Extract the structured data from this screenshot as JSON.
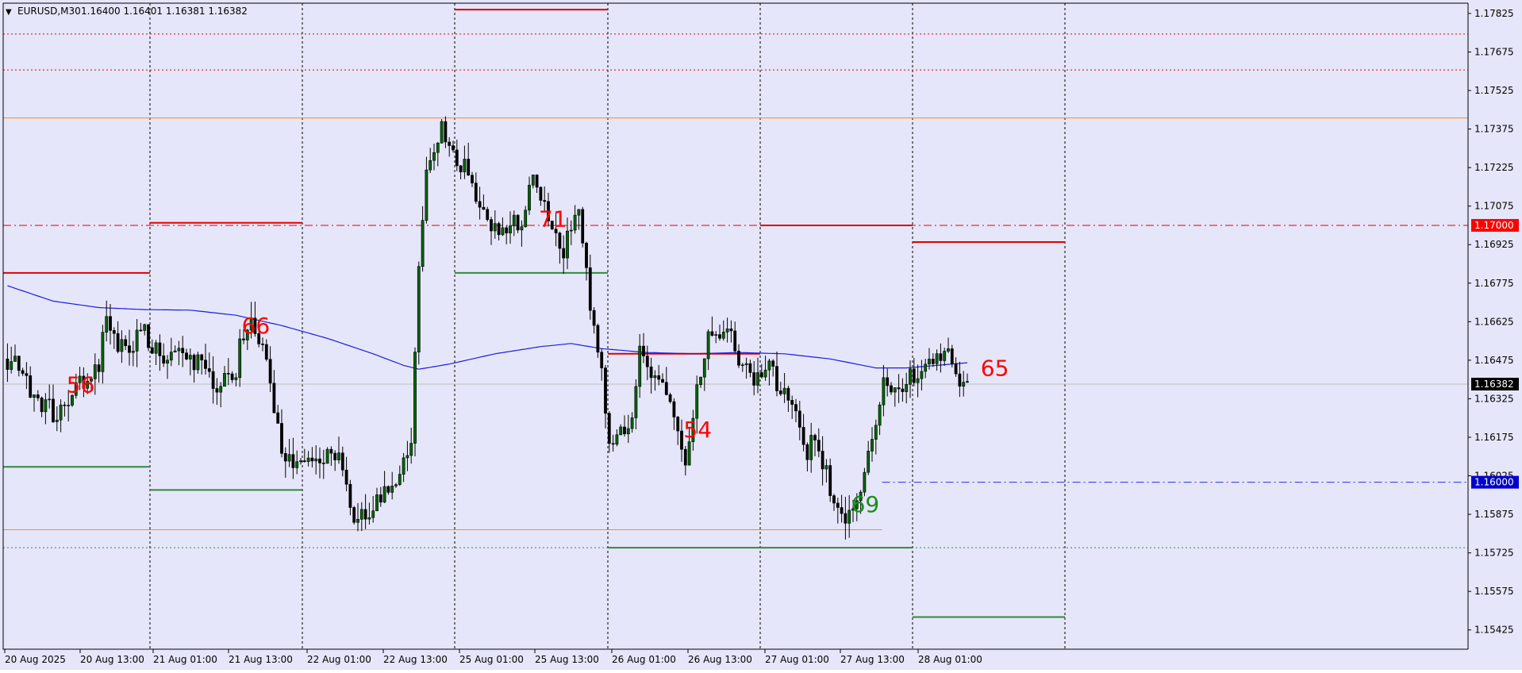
{
  "header": {
    "title": "EURUSD,M30",
    "quote": "1.16400 1.16401 1.16381 1.16382",
    "menu_icon": "triangle-down-icon"
  },
  "colors": {
    "background": "#E6E6FA",
    "grid": "#000000",
    "bull_body": "#006400",
    "bear_body": "#000000",
    "wick": "#000000",
    "ma": "#1c1ce0",
    "red": "#e00000",
    "green": "#2e8b3a",
    "orange": "#ff8c1a",
    "blue_dash": "#2a2aff",
    "gray": "#bfbfbf",
    "label_red": "#ff0000",
    "label_green": "#1a8c1a",
    "current_tag": "#000000",
    "red_tag": "#ff0000",
    "blue_tag": "#0000cc"
  },
  "chart_data": {
    "type": "candlestick",
    "symbol": "EURUSD",
    "timeframe": "M30",
    "ylim": [
      1.1535,
      1.17865
    ],
    "y_ticks": [
      "1.17825",
      "1.17675",
      "1.17525",
      "1.17375",
      "1.17225",
      "1.17075",
      "1.16925",
      "1.16775",
      "1.16625",
      "1.16475",
      "1.16325",
      "1.16175",
      "1.16025",
      "1.15875",
      "1.15725",
      "1.15575",
      "1.15425"
    ],
    "x_ticks": [
      "20 Aug 2025",
      "20 Aug 13:00",
      "21 Aug 01:00",
      "21 Aug 13:00",
      "22 Aug 01:00",
      "22 Aug 13:00",
      "25 Aug 01:00",
      "25 Aug 13:00",
      "26 Aug 01:00",
      "26 Aug 13:00",
      "27 Aug 01:00",
      "27 Aug 13:00",
      "28 Aug 01:00"
    ],
    "current_price": "1.16382",
    "tagged_levels": [
      {
        "value": 1.17,
        "label": "1.17000",
        "color": "red"
      },
      {
        "value": 1.16,
        "label": "1.16000",
        "color": "blue"
      }
    ],
    "series_points": [
      [
        0,
        1.1648
      ],
      [
        2,
        1.1642
      ],
      [
        4,
        1.1632
      ],
      [
        6,
        1.1627
      ],
      [
        8,
        1.1632
      ],
      [
        10,
        1.1641
      ],
      [
        12,
        1.1647
      ],
      [
        13,
        1.1664
      ],
      [
        14,
        1.1656
      ],
      [
        16,
        1.1652
      ],
      [
        18,
        1.1658
      ],
      [
        20,
        1.165
      ],
      [
        22,
        1.1648
      ],
      [
        24,
        1.1647
      ],
      [
        26,
        1.1645
      ],
      [
        27,
        1.1638
      ],
      [
        28,
        1.164
      ],
      [
        30,
        1.1645
      ],
      [
        31,
        1.1658
      ],
      [
        32,
        1.166
      ],
      [
        33,
        1.1655
      ],
      [
        34,
        1.1648
      ],
      [
        35,
        1.1625
      ],
      [
        36,
        1.1612
      ],
      [
        38,
        1.1605
      ],
      [
        40,
        1.161
      ],
      [
        42,
        1.1612
      ],
      [
        44,
        1.1609
      ],
      [
        45,
        1.1592
      ],
      [
        46,
        1.1585
      ],
      [
        48,
        1.1592
      ],
      [
        50,
        1.1598
      ],
      [
        52,
        1.1605
      ],
      [
        53,
        1.1615
      ],
      [
        54,
        1.168
      ],
      [
        55,
        1.172
      ],
      [
        56,
        1.1728
      ],
      [
        57,
        1.1738
      ],
      [
        58,
        1.1728
      ],
      [
        60,
        1.1722
      ],
      [
        62,
        1.171
      ],
      [
        63,
        1.1702
      ],
      [
        64,
        1.1698
      ],
      [
        66,
        1.17
      ],
      [
        68,
        1.1705
      ],
      [
        69,
        1.1718
      ],
      [
        70,
        1.171
      ],
      [
        72,
        1.1695
      ],
      [
        73,
        1.169
      ],
      [
        74,
        1.17
      ],
      [
        75,
        1.1705
      ],
      [
        76,
        1.168
      ],
      [
        77,
        1.166
      ],
      [
        78,
        1.164
      ],
      [
        79,
        1.1615
      ],
      [
        80,
        1.1622
      ],
      [
        82,
        1.1622
      ],
      [
        83,
        1.165
      ],
      [
        85,
        1.164
      ],
      [
        87,
        1.163
      ],
      [
        88,
        1.162
      ],
      [
        89,
        1.161
      ],
      [
        90,
        1.1625
      ],
      [
        91,
        1.1645
      ],
      [
        92,
        1.1655
      ],
      [
        93,
        1.166
      ],
      [
        94,
        1.1655
      ],
      [
        95,
        1.166
      ],
      [
        96,
        1.165
      ],
      [
        98,
        1.164
      ],
      [
        100,
        1.1643
      ],
      [
        102,
        1.1635
      ],
      [
        103,
        1.163
      ],
      [
        104,
        1.1625
      ],
      [
        105,
        1.1612
      ],
      [
        106,
        1.1618
      ],
      [
        107,
        1.1608
      ],
      [
        108,
        1.1598
      ],
      [
        109,
        1.1588
      ],
      [
        110,
        1.1585
      ],
      [
        111,
        1.1588
      ],
      [
        112,
        1.1595
      ],
      [
        113,
        1.161
      ],
      [
        114,
        1.162
      ],
      [
        115,
        1.164
      ],
      [
        116,
        1.1635
      ],
      [
        117,
        1.1632
      ],
      [
        118,
        1.1638
      ],
      [
        120,
        1.1645
      ],
      [
        122,
        1.1648
      ],
      [
        123,
        1.1652
      ],
      [
        124,
        1.1645
      ],
      [
        125,
        1.164
      ],
      [
        126,
        1.1638
      ]
    ],
    "ma_points": [
      [
        0,
        1.16765
      ],
      [
        6,
        1.16705
      ],
      [
        12,
        1.1668
      ],
      [
        18,
        1.16672
      ],
      [
        24,
        1.1667
      ],
      [
        30,
        1.1665
      ],
      [
        36,
        1.1661
      ],
      [
        42,
        1.1656
      ],
      [
        48,
        1.165
      ],
      [
        52,
        1.16455
      ],
      [
        54,
        1.1644
      ],
      [
        58,
        1.1646
      ],
      [
        64,
        1.165
      ],
      [
        70,
        1.16528
      ],
      [
        74,
        1.1654
      ],
      [
        78,
        1.1652
      ],
      [
        84,
        1.16505
      ],
      [
        90,
        1.165
      ],
      [
        96,
        1.16505
      ],
      [
        102,
        1.165
      ],
      [
        108,
        1.1648
      ],
      [
        114,
        1.16445
      ],
      [
        118,
        1.16445
      ],
      [
        124,
        1.1646
      ],
      [
        126,
        1.16465
      ]
    ],
    "annotations": [
      {
        "text": "56",
        "bar": 8,
        "value": 1.1635,
        "color": "label_red"
      },
      {
        "text": "66",
        "bar": 31,
        "value": 1.1658,
        "color": "label_red"
      },
      {
        "text": "71",
        "bar": 70,
        "value": 1.16995,
        "color": "label_red"
      },
      {
        "text": "54",
        "bar": 89,
        "value": 1.16175,
        "color": "label_red"
      },
      {
        "text": "69",
        "bar": 111,
        "value": 1.15885,
        "color": "label_green"
      },
      {
        "text": "65",
        "bar": 128,
        "value": 1.16415,
        "color": "label_red"
      }
    ],
    "levels": [
      {
        "value": 1.17745,
        "x1": 0,
        "x2": 1,
        "style": "dotted",
        "color": "red"
      },
      {
        "value": 1.17605,
        "x1": 0,
        "x2": 1,
        "style": "dotted",
        "color": "red"
      },
      {
        "value": 1.17418,
        "x1": 0,
        "x2": 1,
        "style": "solid",
        "color": "orange"
      },
      {
        "value": 1.17,
        "x1": 0,
        "x2": 1,
        "style": "dashdot",
        "color": "red"
      },
      {
        "value": 1.15815,
        "x1": 0,
        "x2": 0.6,
        "style": "solid",
        "color": "orange"
      },
      {
        "value": 1.16,
        "x1": 0.6,
        "x2": 1,
        "style": "dashdot",
        "color": "blue_dash"
      },
      {
        "value": 1.15745,
        "x1": 0,
        "x2": 1,
        "style": "dotted",
        "color": "green"
      },
      {
        "value": 1.16382,
        "x1": 0,
        "x2": 1,
        "style": "solid",
        "color": "gray"
      }
    ],
    "day_segments": [
      {
        "day": 0,
        "value": 1.16815,
        "color": "red"
      },
      {
        "day": 0,
        "value": 1.1606,
        "color": "green"
      },
      {
        "day": 1,
        "value": 1.1701,
        "color": "red"
      },
      {
        "day": 1,
        "value": 1.1597,
        "color": "green"
      },
      {
        "day": 3,
        "value": 1.1784,
        "color": "red"
      },
      {
        "day": 3,
        "value": 1.16815,
        "color": "green"
      },
      {
        "day": 4,
        "value": 1.165,
        "color": "red"
      },
      {
        "day": 4,
        "value": 1.15745,
        "color": "green"
      },
      {
        "day": 5,
        "value": 1.17,
        "color": "red"
      },
      {
        "day": 5,
        "value": 1.15745,
        "color": "green"
      },
      {
        "day": 6,
        "value": 1.16935,
        "color": "red"
      },
      {
        "day": 6,
        "value": 1.15475,
        "color": "green"
      }
    ]
  }
}
